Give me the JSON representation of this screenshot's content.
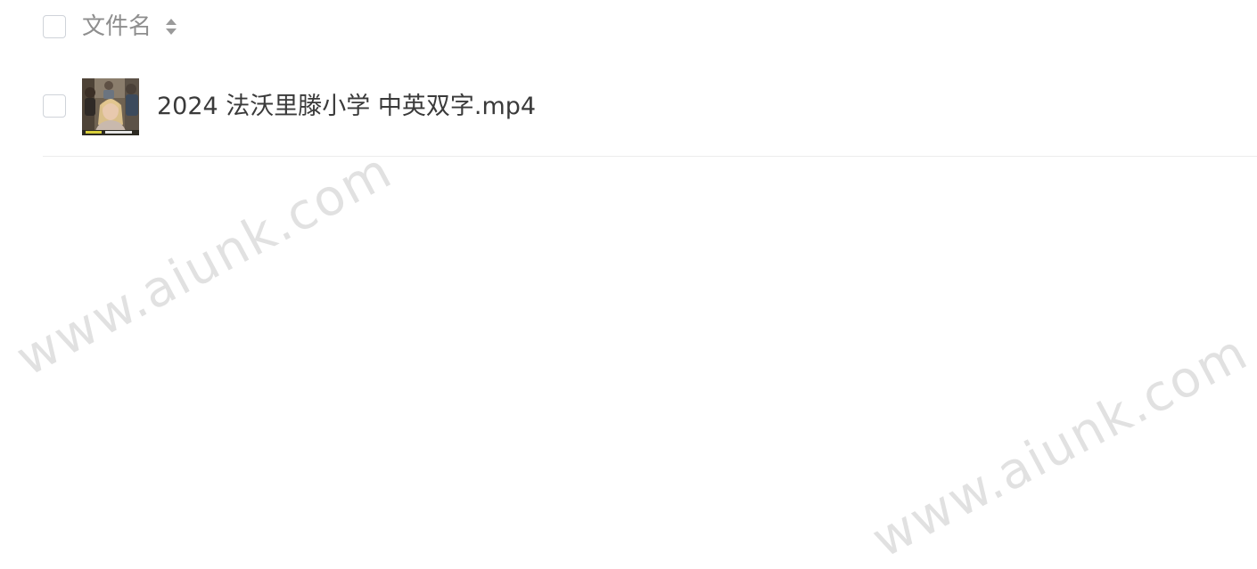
{
  "header": {
    "column_label": "文件名",
    "sort_icon": "sort-up-down-icon"
  },
  "files": [
    {
      "name": "2024 法沃里滕小学 中英双字.mp4",
      "thumbnail_icon": "video-thumbnail"
    }
  ],
  "watermark": {
    "text": "www.aiunk.com"
  },
  "colors": {
    "text": "#3a3a3a",
    "header_text": "#8e8e8e",
    "checkbox_border": "#cfd3d9",
    "divider": "#ececec",
    "watermark": "#c8c8c8"
  }
}
